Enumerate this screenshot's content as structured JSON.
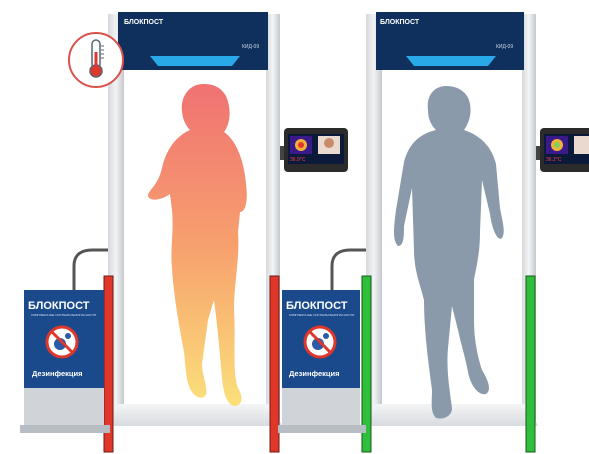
{
  "left_gate": {
    "brand": "БЛОКПОСТ",
    "model": "КИД-09",
    "indicator_color": "#e0372b"
  },
  "right_gate": {
    "brand": "БЛОКПОСТ",
    "model": "КИД-09",
    "indicator_color": "#2fbf3a"
  },
  "left_disinfector": {
    "brand": "БЛОКПОСТ",
    "tagline": "КОМПЛЕКСНЫЕ СИСТЕМЫ БЕЗОПАСНОСТИ",
    "label": "Дезинфекция"
  },
  "right_disinfector": {
    "brand": "БЛОКПОСТ",
    "tagline": "КОМПЛЕКСНЫЕ СИСТЕМЫ БЕЗОПАСНОСТИ",
    "label": "Дезинфекция"
  },
  "monitor_left": {
    "temperature": "36.9°C"
  },
  "monitor_right": {
    "temperature": "36.2°C"
  },
  "thermometer_badge": {
    "icon": "thermometer-icon",
    "ring_color": "#d9534a"
  },
  "colors": {
    "frame": "#c9ccd1",
    "header": "#0f2f5c",
    "light_bar": "#29a9e8",
    "person_dark": "#8a9aaa"
  }
}
